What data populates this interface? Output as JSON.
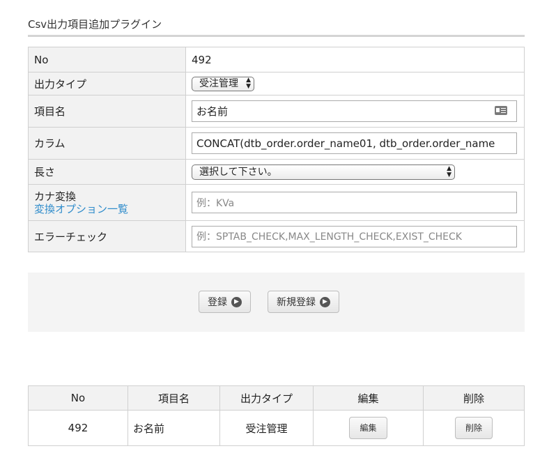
{
  "page_title": "Csv出力項目追加プラグイン",
  "form": {
    "no_label": "No",
    "no_value": "492",
    "output_type_label": "出力タイプ",
    "output_type_value": "受注管理",
    "item_name_label": "項目名",
    "item_name_value": "お名前",
    "column_label": "カラム",
    "column_value": "CONCAT(dtb_order.order_name01, dtb_order.order_name",
    "length_label": "長さ",
    "length_value": "選択して下さい。",
    "kana_label": "カナ変換",
    "kana_options_link": "変換オプション一覧",
    "kana_placeholder": "例：KVa",
    "error_check_label": "エラーチェック",
    "error_check_placeholder": "例：SPTAB_CHECK,MAX_LENGTH_CHECK,EXIST_CHECK"
  },
  "buttons": {
    "register": "登録",
    "new_register": "新規登録"
  },
  "list": {
    "headers": [
      "No",
      "項目名",
      "出力タイプ",
      "編集",
      "削除"
    ],
    "rows": [
      {
        "no": "492",
        "item_name": "お名前",
        "output_type": "受注管理",
        "edit": "編集",
        "delete": "削除"
      }
    ]
  },
  "icons": {
    "select_arrows": "up-down-arrows-icon",
    "address_card": "address-card-icon",
    "button_arrow": "circle-arrow-right-icon"
  }
}
